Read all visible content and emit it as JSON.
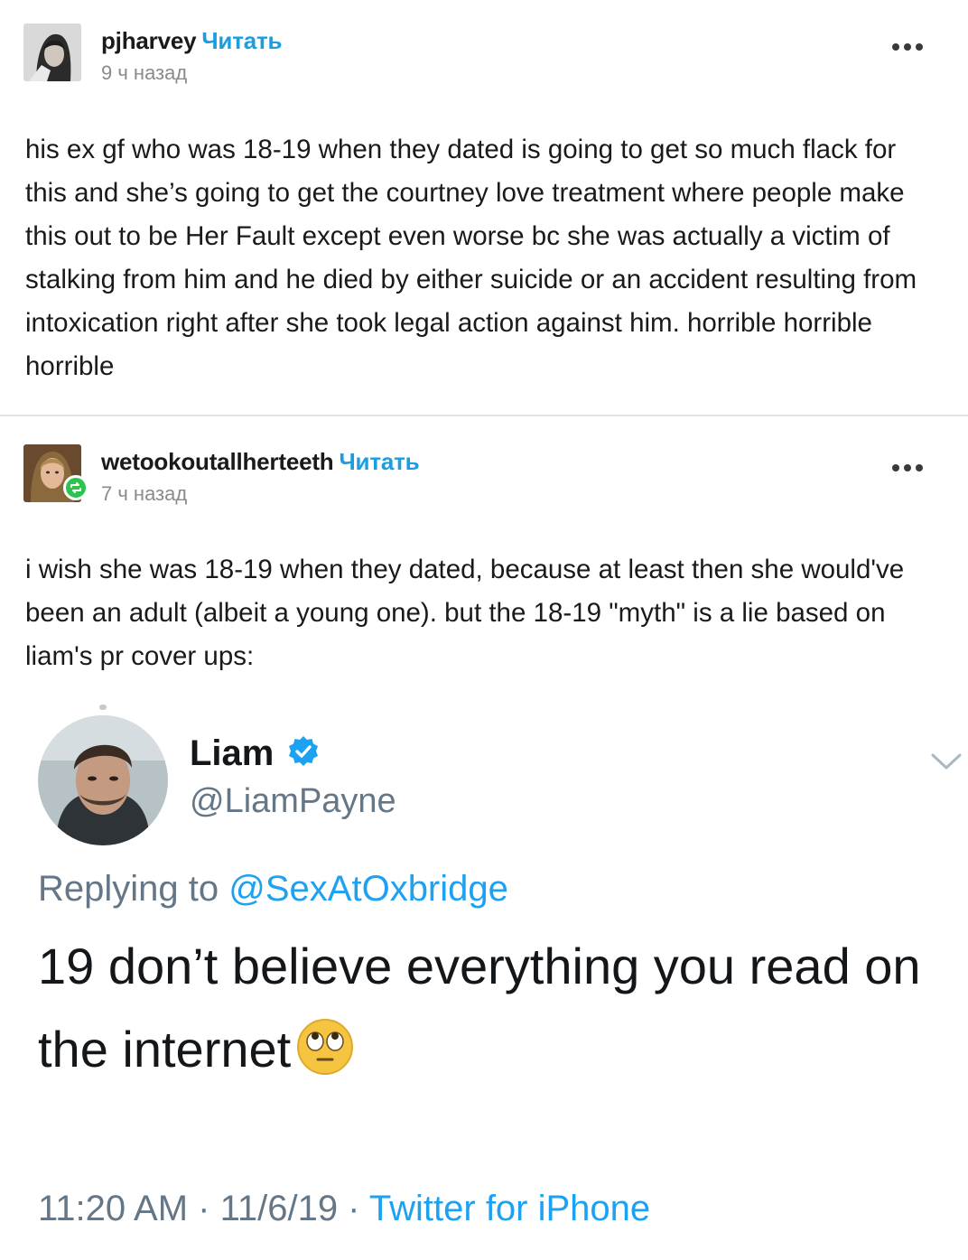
{
  "posts": [
    {
      "username": "pjharvey",
      "follow_label": "Читать",
      "timestamp": "9 ч назад",
      "more_icon": "ellipsis-icon",
      "body": "his ex gf who was 18-19 when they dated is going to get so much flack for this and she’s going to get the courtney love treatment where people make this out to be Her Fault except even worse bc she was actually a victim of stalking from him and he died by either suicide or an accident resulting from intoxication right after she took legal action against him. horrible horrible horrible"
    },
    {
      "username": "wetookoutallherteeth",
      "follow_label": "Читать",
      "timestamp": "7 ч назад",
      "more_icon": "ellipsis-icon",
      "badge_icon": "reblog-icon",
      "body": "i wish she was 18-19 when they dated, because at least then she would've been an adult (albeit a young one). but the 18-19 \"myth\" is a lie based on liam's pr cover ups:"
    }
  ],
  "tweet": {
    "name": "Liam",
    "handle": "@LiamPayne",
    "reply_prefix": "Replying to",
    "reply_handle": "@SexAtOxbridge",
    "text": "19 don’t believe everything you read on the internet",
    "emoji": "face-with-rolling-eyes",
    "time": "11:20 AM · 11/6/19 ·",
    "source": "Twitter for iPhone"
  },
  "colors": {
    "follow_blue": "#1a9ee0",
    "twitter_blue": "#1da1f2",
    "reblog_green": "#2cc44c",
    "muted_gray": "#8a8a8a"
  }
}
